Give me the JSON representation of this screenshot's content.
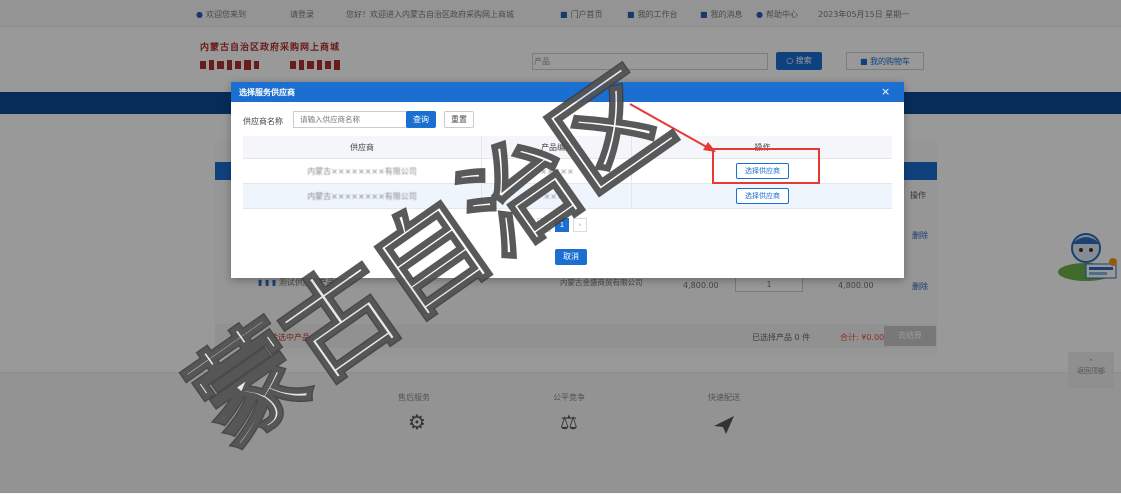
{
  "topbar": {
    "items": [
      "欢迎您来到",
      "请登录",
      "您好！欢迎进入内蒙古自治区政府采购网上商城",
      "门户首页",
      "我的工作台",
      "我的消息",
      "帮助中心",
      "2023年05月15日 星期一"
    ]
  },
  "header": {
    "logo_line1": "内蒙古自治区政府采购网上商城",
    "search_type": "产品",
    "search_label": "搜索",
    "cart_label": "我的购物车"
  },
  "modal": {
    "title": "选择服务供应商",
    "close_icon": "×",
    "filter": {
      "label": "供应商名称",
      "placeholder": "请输入供应商名称",
      "search_label": "查询",
      "reset_label": "重置"
    },
    "table": {
      "headers": [
        "供应商",
        "产品编码",
        "操作"
      ],
      "rows": [
        {
          "supplier": "内蒙古××××××××有限公司",
          "code": "×××××",
          "action": "选择供应商"
        },
        {
          "supplier": "内蒙古××××××××有限公司",
          "code": "××××",
          "action": "选择供应商"
        }
      ]
    },
    "pager": {
      "prev": "‹",
      "current": "1",
      "next": "›"
    },
    "cancel_label": "取消"
  },
  "cart": {
    "op_header": "操作",
    "op_label": "删除",
    "product_name": "测试供应商产品",
    "supplier_name": "内蒙古金盛商贸有限公司",
    "price": "4,800.00",
    "quantity": "1",
    "total": "4,800.00",
    "select_all": "全选",
    "delete_selected": "删除选中产品",
    "selected_count": "已选择产品 0 件",
    "sum_label": "合计: ¥0.00",
    "checkout_label": "去结算"
  },
  "footer": {
    "items": [
      {
        "label": "售后服务",
        "icon": "gear-icon"
      },
      {
        "label": "公平竞争",
        "icon": "scale-icon"
      },
      {
        "label": "快速配送",
        "icon": "paper-plane-icon"
      }
    ]
  },
  "side": {
    "back_to_top": "返回顶部"
  },
  "watermark": {
    "text": "蒙古自治区"
  },
  "colors": {
    "primary": "#1a6fd1",
    "navbar": "#0d4a95",
    "highlight": "#e53935",
    "logo": "#b03030"
  }
}
